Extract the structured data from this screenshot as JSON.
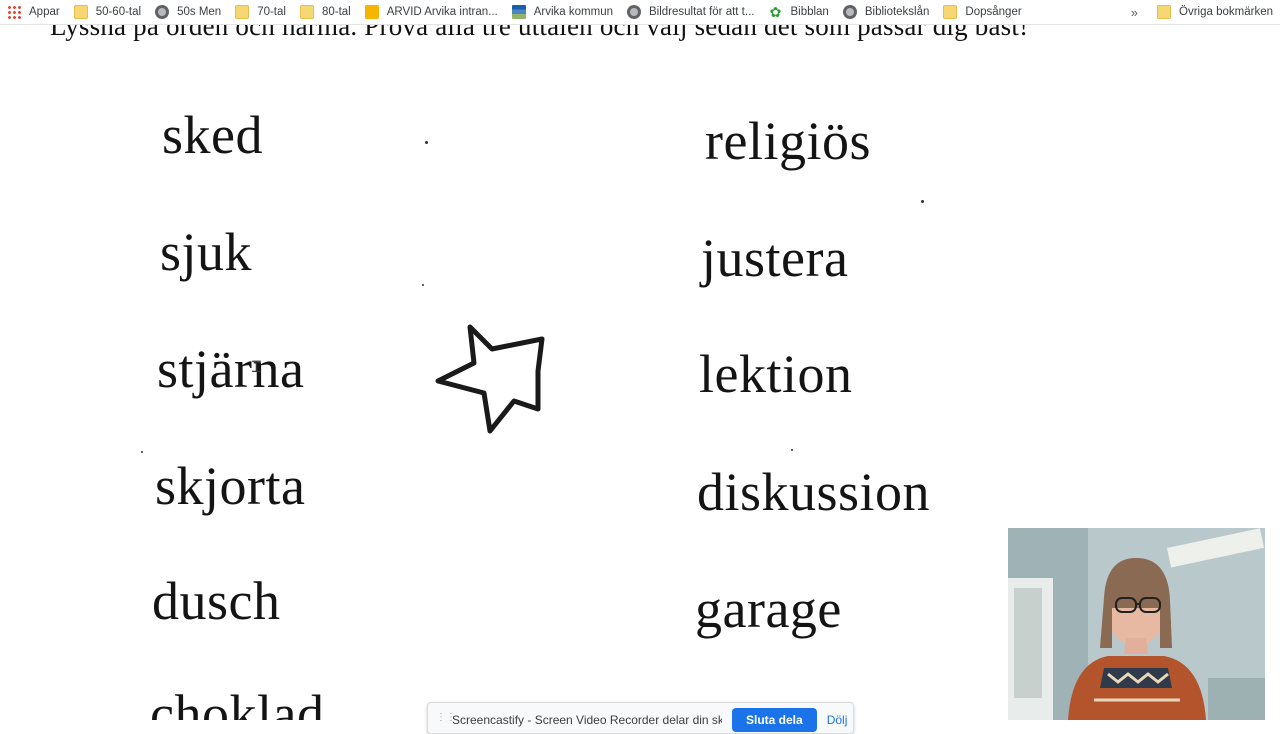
{
  "bookmarks_bar": {
    "items": [
      {
        "label": "Appar",
        "icon": "apps-grid-icon"
      },
      {
        "label": "50-60-tal",
        "icon": "folder-icon"
      },
      {
        "label": "50s Men",
        "icon": "globe-icon"
      },
      {
        "label": "70-tal",
        "icon": "folder-icon"
      },
      {
        "label": "80-tal",
        "icon": "folder-icon"
      },
      {
        "label": "ARVID Arvika intran...",
        "icon": "arvid-icon"
      },
      {
        "label": "Arvika kommun",
        "icon": "arvika-kommun-icon"
      },
      {
        "label": "Bildresultat för att t...",
        "icon": "globe-icon"
      },
      {
        "label": "Bibblan",
        "icon": "clover-icon"
      },
      {
        "label": "Bibliotekslån",
        "icon": "globe-icon"
      },
      {
        "label": "Dopsånger",
        "icon": "folder-icon"
      }
    ],
    "overflow_label": "»",
    "other_bookmarks_label": "Övriga bokmärken"
  },
  "worksheet": {
    "instruction": "Lyssna på orden och härma. Prova alla tre uttalen och välj sedan det som passar dig bäst!",
    "left_words": [
      "sked",
      "sjuk",
      "stjärna",
      "skjorta",
      "dusch",
      "choklad"
    ],
    "right_words": [
      "religiös",
      "justera",
      "lektion",
      "diskussion",
      "garage"
    ]
  },
  "share_bar": {
    "message": "Screencastify - Screen Video Recorder delar din skärm",
    "stop_label": "Sluta dela",
    "hide_label": "Dölj"
  },
  "webcam": {
    "description_icon": "webcam-person"
  }
}
